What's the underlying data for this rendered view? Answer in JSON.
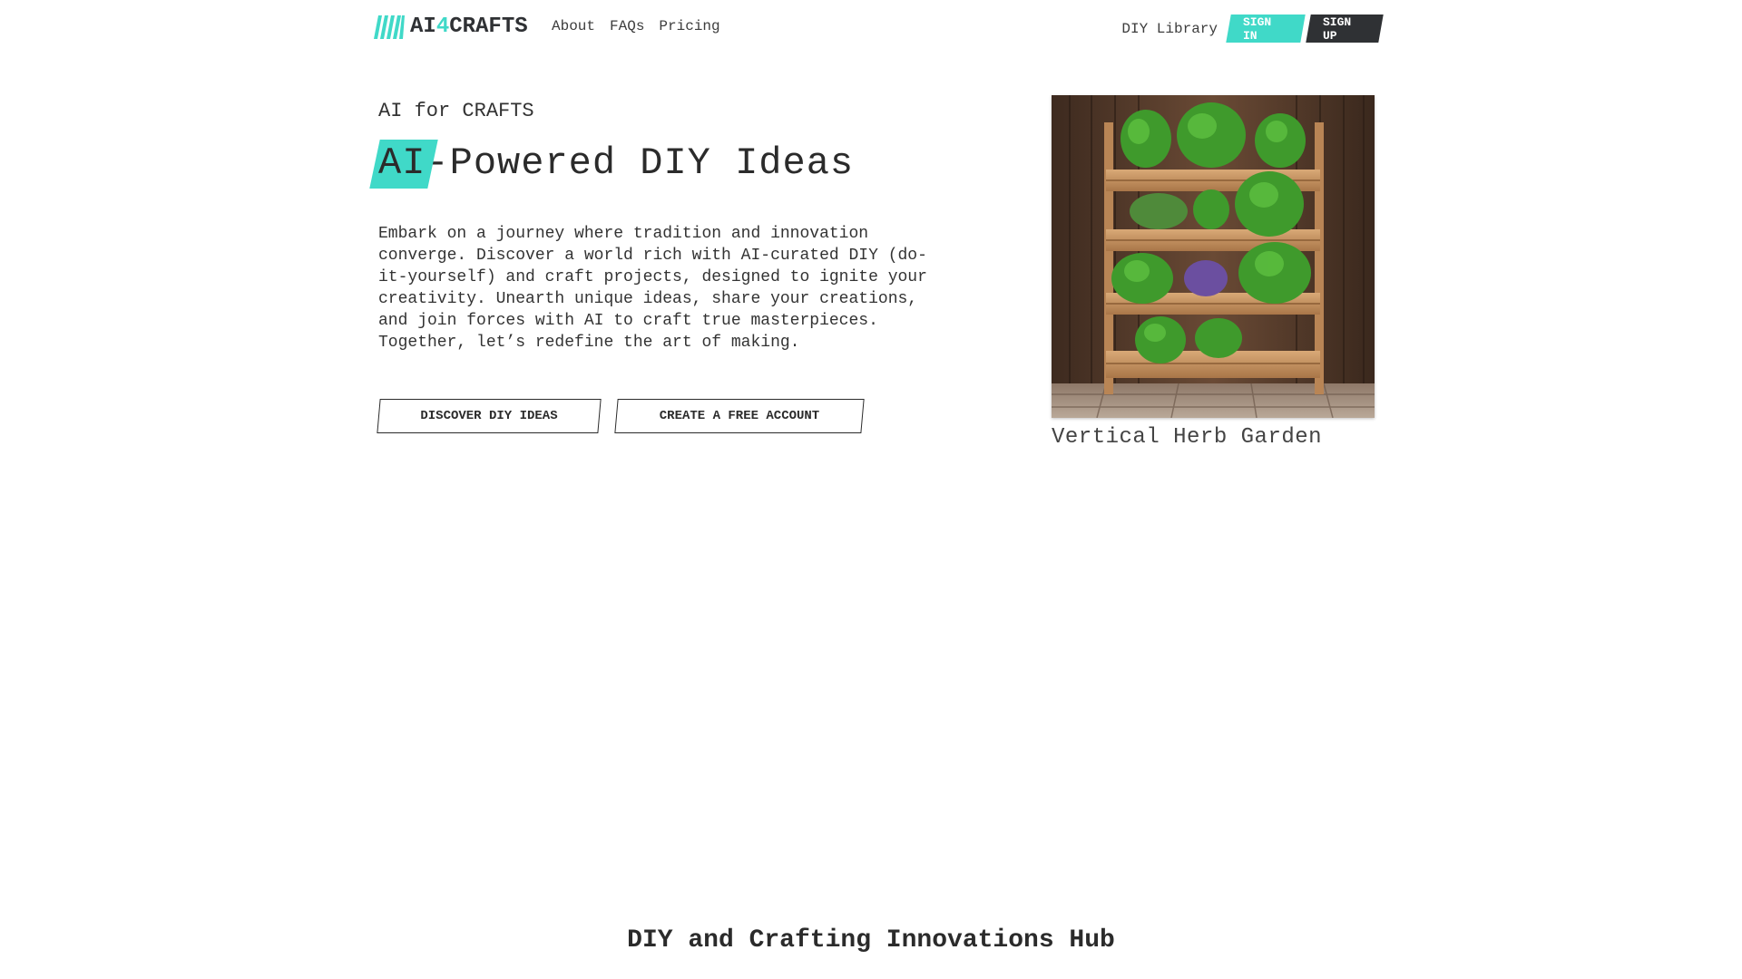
{
  "nav": {
    "logo": {
      "prefix": "AI",
      "four": "4",
      "suffix": "CRAFTS"
    },
    "links": [
      "About",
      "FAQs",
      "Pricing"
    ],
    "library_label": "DIY Library",
    "sign_in": "SIGN IN",
    "sign_up": "SIGN UP"
  },
  "hero": {
    "eyebrow": "AI for CRAFTS",
    "headline_highlight": "AI",
    "headline_rest": "-Powered DIY Ideas",
    "description": "Embark on a journey where tradition and innovation converge. Discover a world rich with AI-curated DIY (do-it-yourself) and craft projects, designed to ignite your creativity. Unearth unique ideas, share your creations, and join forces with AI to craft true masterpieces. Together, let’s redefine the art of making.",
    "cta_primary": "DISCOVER DIY IDEAS",
    "cta_secondary": "CREATE A FREE ACCOUNT"
  },
  "feature": {
    "image_subject": "vertical-herb-garden-photo",
    "caption": "Vertical Herb Garden"
  },
  "section": {
    "title": "DIY and Crafting Innovations Hub"
  },
  "colors": {
    "accent": "#40d9c8",
    "dark": "#2f3134",
    "text": "#2b2b2b"
  }
}
